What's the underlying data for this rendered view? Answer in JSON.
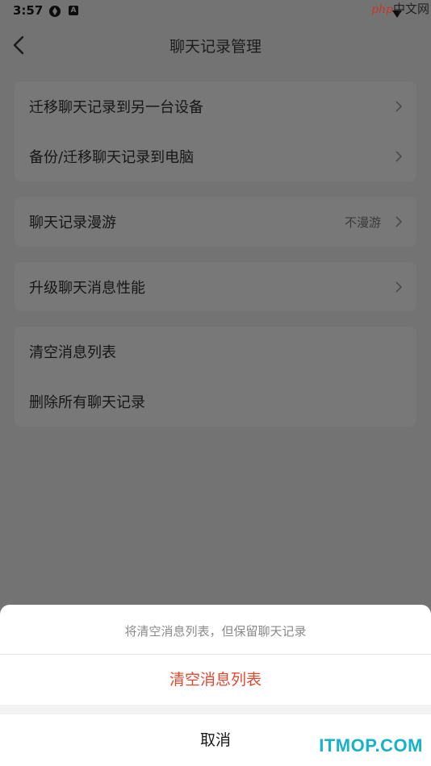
{
  "status_bar": {
    "time": "3:57",
    "app_badge_letter": "A"
  },
  "watermark_top": {
    "php": "php",
    "cn": "中文网"
  },
  "header": {
    "title": "聊天记录管理",
    "back_icon": "chevron-left-icon"
  },
  "groups": [
    {
      "items": [
        {
          "label": "迁移聊天记录到另一台设备"
        },
        {
          "label": "备份/迁移聊天记录到电脑"
        }
      ]
    },
    {
      "items": [
        {
          "label": "聊天记录漫游",
          "value": "不漫游"
        }
      ]
    },
    {
      "items": [
        {
          "label": "升级聊天消息性能"
        }
      ]
    },
    {
      "items": [
        {
          "label": "清空消息列表"
        },
        {
          "label": "删除所有聊天记录"
        }
      ]
    }
  ],
  "action_sheet": {
    "hint": "将清空消息列表，但保留聊天记录",
    "confirm_label": "清空消息列表",
    "cancel_label": "取消"
  },
  "watermark_bottom": "ITMOP.COM",
  "colors": {
    "confirm": "#e0482f",
    "overlay": "#737373",
    "watermark_bottom": "#16b2c8"
  }
}
